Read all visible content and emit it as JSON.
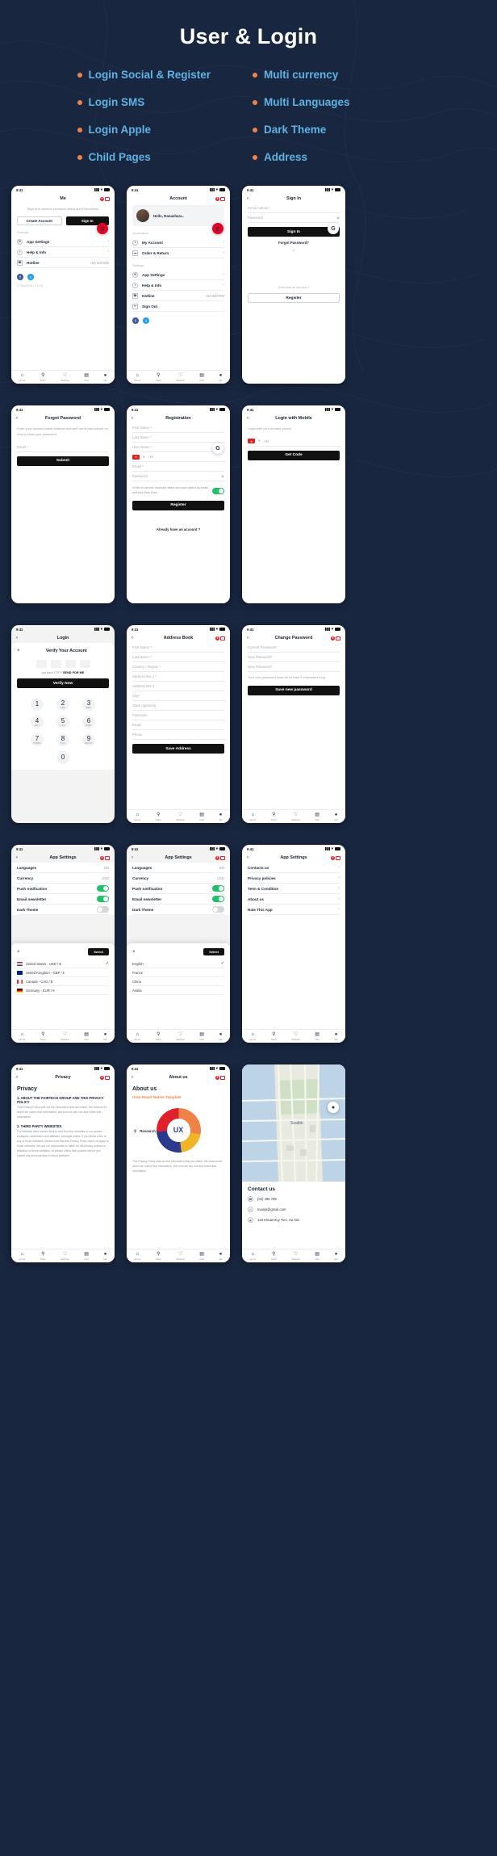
{
  "hero": {
    "title": "User & Login",
    "features": [
      "Login Social & Register",
      "Multi currency",
      "Login SMS",
      "Multi Languages",
      "Login Apple",
      "Dark Theme",
      "Child Pages",
      "Address"
    ]
  },
  "status": {
    "time": "9:41"
  },
  "tabbar": {
    "items": [
      "Home",
      "Shop",
      "Wishlist",
      "Cart",
      "Me"
    ]
  },
  "screens": {
    "me": {
      "title": "Me",
      "note": "Sign in to receive exclusive offers and Promotions",
      "create_account": "Create Account",
      "sign_in": "Sign In",
      "settings_label": "Settings",
      "items": [
        {
          "label": "App Settings",
          "value": ""
        },
        {
          "label": "Help & Info",
          "value": ""
        },
        {
          "label": "Hotline",
          "value": "+84 000 000"
        }
      ],
      "copyright": "© Oreo 2019 | V 1.0.5"
    },
    "account": {
      "title": "Account",
      "greeting": "Hello, Ranashara..",
      "information_label": "Information",
      "info_items": [
        "My Account",
        "Order & Return"
      ],
      "settings_label": "Settings",
      "settings_items": [
        {
          "label": "App Settings",
          "value": ""
        },
        {
          "label": "Help & Info",
          "value": ""
        },
        {
          "label": "Hotline",
          "value": "+84 000 000"
        },
        {
          "label": "Sign Out",
          "value": ""
        }
      ],
      "cart_badge": "0"
    },
    "signin": {
      "title": "Sign In",
      "email_placeholder": "Email Adress *",
      "password_placeholder": "Password",
      "submit": "Sign In",
      "forgot": "Forgot Password?",
      "or": "or",
      "no_account": "Dont have an account ?",
      "register": "Register"
    },
    "forgot": {
      "title": "Forgot Password",
      "helper": "Enter your account email address and we'll send instructions on how to reset your password",
      "email_placeholder": "Email *",
      "submit": "Submit"
    },
    "registration": {
      "title": "Registration",
      "fields": [
        "First Name *",
        "Last Name *",
        "User Name *"
      ],
      "phone_code": "+84",
      "email_placeholder": "Email *",
      "password_placeholder": "Password",
      "consent": "I'd like to receive exclusive offers and style advice by email and sms from Oreo",
      "submit": "Register",
      "already": "Already have an account ?"
    },
    "login_mobile": {
      "title": "Login with Mobile",
      "helper": "Login with your number phone",
      "phone_code": "+84",
      "submit": "Get Code"
    },
    "otp": {
      "title": "Login",
      "sheet_title": "Verify Your Account",
      "hint_prefix": "got back OTP?",
      "hint_action": "SEND FOR ME",
      "submit": "Verify Now",
      "keys": [
        {
          "n": "1",
          "s": ""
        },
        {
          "n": "2",
          "s": "ABC"
        },
        {
          "n": "3",
          "s": "DEF"
        },
        {
          "n": "4",
          "s": "GHI"
        },
        {
          "n": "5",
          "s": "JKL"
        },
        {
          "n": "6",
          "s": "MNO"
        },
        {
          "n": "7",
          "s": "PQRS"
        },
        {
          "n": "8",
          "s": "TUV"
        },
        {
          "n": "9",
          "s": "WXYZ"
        },
        {
          "n": "0",
          "s": ""
        }
      ]
    },
    "address_book": {
      "title": "Address Book",
      "fields": [
        "First Name *",
        "Last Name *",
        "Country / Region *",
        "Address line 1 *",
        "Address line 2",
        "City*",
        "State (optional)",
        "Postcode",
        "Email",
        "Phone"
      ],
      "submit": "Save Address"
    },
    "change_password": {
      "title": "Change Password",
      "fields": [
        "Current Password*",
        "New Password*",
        "New Password*"
      ],
      "helper": "Your new password must be at least 6 characters long",
      "submit": "Save new password"
    },
    "app_settings_currency": {
      "title": "App Settings",
      "rows": [
        {
          "label": "Languages",
          "value": "EN"
        },
        {
          "label": "Currency",
          "value": "USD"
        }
      ],
      "toggles": [
        {
          "label": "Push notification",
          "on": true
        },
        {
          "label": "Email newsletter",
          "on": true
        },
        {
          "label": "Dark Theme",
          "on": false
        }
      ],
      "picker_button": "Select",
      "options": [
        {
          "label": "United States - USD / $",
          "checked": true
        },
        {
          "label": "United Kingdom - GBP / £",
          "checked": false
        },
        {
          "label": "Canada - CAD / $",
          "checked": false
        },
        {
          "label": "Germany - EUR / €",
          "checked": false
        }
      ]
    },
    "app_settings_language": {
      "title": "App Settings",
      "rows": [
        {
          "label": "Languages",
          "value": "EN"
        },
        {
          "label": "Currency",
          "value": "USD"
        }
      ],
      "toggles": [
        {
          "label": "Push notification",
          "on": true
        },
        {
          "label": "Email newsletter",
          "on": true
        },
        {
          "label": "Dark Theme",
          "on": false
        }
      ],
      "picker_button": "Select",
      "options": [
        {
          "label": "English",
          "checked": true
        },
        {
          "label": "France",
          "checked": false
        },
        {
          "label": "China",
          "checked": false
        },
        {
          "label": "Arabic",
          "checked": false
        }
      ]
    },
    "app_settings_menu": {
      "title": "App Settings",
      "items": [
        "Contacts us",
        "Privacy policies",
        "Term & Condition",
        "About us",
        "Rate This App"
      ]
    },
    "privacy": {
      "title": "Privacy",
      "heading": "Privacy",
      "s1_title": "1.  ABOUT THE FAIRTECH GROUP AND THIS PRIVACY POLICY",
      "s1_body": "This Privacy Policy sets out the information that we collect, the reasons for which we collect that information, and how we can use and share that information.",
      "s2_title": "2.  THIRD PARTY WEBSITES",
      "s2_body": "Our Website uses contain links to and from the websites of our partner boutiques, advertisers and affiliates, amongst others. If you follow a link to any of these websites, please note that this Privacy Policy does not apply to those websites. We are not responsible or liable for the privacy policies or practices of those websites, so please check their policies before you submit any personal data to those websites."
    },
    "about": {
      "title": "About us",
      "heading": "About us",
      "subtitle": "Oreo React Native Template",
      "research_label": "Research",
      "ux_label": "UX",
      "body": "This Privacy Policy sets out the information that we collect, the reasons for which we collect that information, and how we can use and share that information."
    },
    "contact": {
      "heading": "Contact us",
      "rows": [
        {
          "icon": "phone-icon",
          "text": "(02) 455 789"
        },
        {
          "icon": "mail-icon",
          "text": "mainjs@gmail.com"
        },
        {
          "icon": "map-pin-icon",
          "text": "123 Khuat Duy Tien, Ha Noi"
        }
      ]
    }
  },
  "colors": {
    "bg": "#18263f",
    "accent": "#ef8347",
    "feature_text": "#5fb3e4",
    "dark_button": "#111111",
    "toggle_on": "#1fc26b",
    "badge_red": "#e0202a"
  }
}
